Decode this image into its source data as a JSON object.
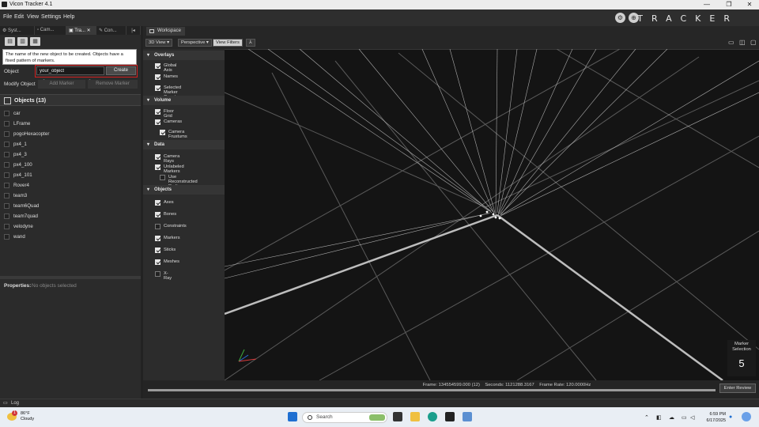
{
  "window": {
    "title": "Vicon Tracker 4.1",
    "controls": [
      "—",
      "❐",
      "✕"
    ]
  },
  "menu": [
    "File",
    "Edit",
    "View",
    "Settings",
    "Help"
  ],
  "brand": "TRACKER",
  "left_tabs": [
    "Syst...",
    "Cam...",
    "Tra...",
    "Con..."
  ],
  "tooltip": "The name of the new object to be created. Objects have a fixed pattern of markers.",
  "object_form": {
    "label": "Object",
    "value": "your_object",
    "create": "Create",
    "modify_label": "Modify Object",
    "add_marker": "Add Marker",
    "remove_marker": "Remove Marker"
  },
  "objects": {
    "header": "Objects (13)",
    "items": [
      "car",
      "LFrame",
      "pogoHexacopter",
      "px4_1",
      "px4_3",
      "px4_100",
      "px4_101",
      "Rover4",
      "team3",
      "team6Quad",
      "team7quad",
      "velodyne",
      "wand"
    ]
  },
  "properties": {
    "label": "Properties:",
    "value": "No objects selected"
  },
  "workspace": {
    "tab": "Workspace",
    "view_select": "3D View",
    "projection": "Perspective",
    "filters_btn": "View Filters"
  },
  "filters": {
    "overlays": {
      "title": "Overlays",
      "items": [
        {
          "label": "Global Axis",
          "on": true
        },
        {
          "label": "Names",
          "on": true
        },
        {
          "label": "Selected Marker Count",
          "on": true
        }
      ]
    },
    "volume": {
      "title": "Volume",
      "items": [
        {
          "label": "Floor Grid",
          "on": true
        },
        {
          "label": "Cameras",
          "on": true
        },
        {
          "label": "Camera Frustums",
          "on": true
        }
      ]
    },
    "data": {
      "title": "Data",
      "items": [
        {
          "label": "Camera Rays",
          "on": true
        },
        {
          "label": "Unlabeled Markers",
          "on": true
        },
        {
          "label": "Use Reconstructed Radius",
          "on": false
        }
      ]
    },
    "objects": {
      "title": "Objects",
      "items": [
        {
          "label": "Axes",
          "on": true
        },
        {
          "label": "Bones",
          "on": true
        },
        {
          "label": "Constraints",
          "on": false
        },
        {
          "label": "Markers",
          "on": true
        },
        {
          "label": "Sticks",
          "on": true
        },
        {
          "label": "Meshes",
          "on": true
        },
        {
          "label": "X-Ray",
          "on": false
        }
      ]
    }
  },
  "marker_selection": {
    "label": "Marker Selection",
    "count": "5"
  },
  "timeline": {
    "info": "Frame: 134554599.000 (12)    Seconds: 1121288.3167    Frame Rate: 120.0000Hz",
    "review": "Enter Review"
  },
  "log": "Log",
  "taskbar": {
    "temp": "86°F",
    "condition": "Cloudy",
    "badge": "1",
    "search": "Search",
    "time": "6:59 PM",
    "date": "6/17/2025"
  },
  "colors": {
    "accent_red": "#d31f1f",
    "panel": "#2b2b2b",
    "viewport": "#141414"
  }
}
